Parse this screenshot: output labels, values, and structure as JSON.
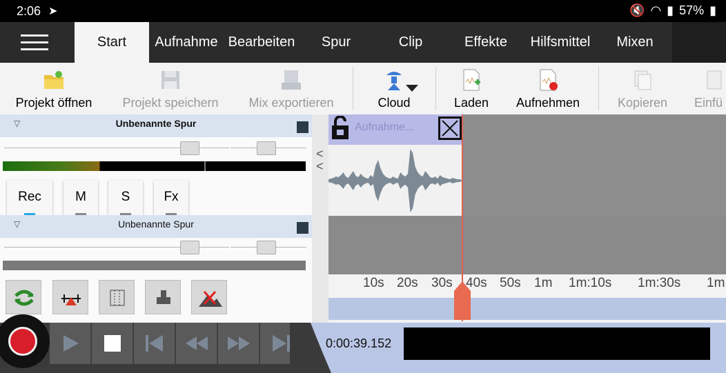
{
  "status_bar": {
    "time": "2:06",
    "battery": "57%"
  },
  "tabs": [
    {
      "label": "Start"
    },
    {
      "label": "Aufnahme"
    },
    {
      "label": "Bearbeiten"
    },
    {
      "label": "Spur"
    },
    {
      "label": "Clip"
    },
    {
      "label": "Effekte"
    },
    {
      "label": "Hilfsmittel"
    },
    {
      "label": "Mixen"
    }
  ],
  "toolbar": {
    "open_label": "Projekt öffnen",
    "save_label": "Projekt speichern",
    "export_label": "Mix exportieren",
    "cloud_label": "Cloud",
    "load_label": "Laden",
    "record_label": "Aufnehmen",
    "copy_label": "Kopieren",
    "paste_label": "Einfü"
  },
  "tracks": [
    {
      "name": "Unbenannte Spur",
      "buttons": [
        "Rec",
        "M",
        "S",
        "Fx"
      ]
    },
    {
      "name": "Unbenannte Spur"
    }
  ],
  "clip": {
    "title": "Aufnahme..."
  },
  "timeline": {
    "ticks": [
      "10s",
      "20s",
      "30s",
      "40s",
      "50s",
      "1m",
      "1m:10s",
      "1m:30s",
      "1m"
    ]
  },
  "transport": {
    "time": "0:00:39.152"
  },
  "colors": {
    "accent": "#b7b9e6",
    "playhead": "#e06050",
    "record": "#d81e2a"
  }
}
